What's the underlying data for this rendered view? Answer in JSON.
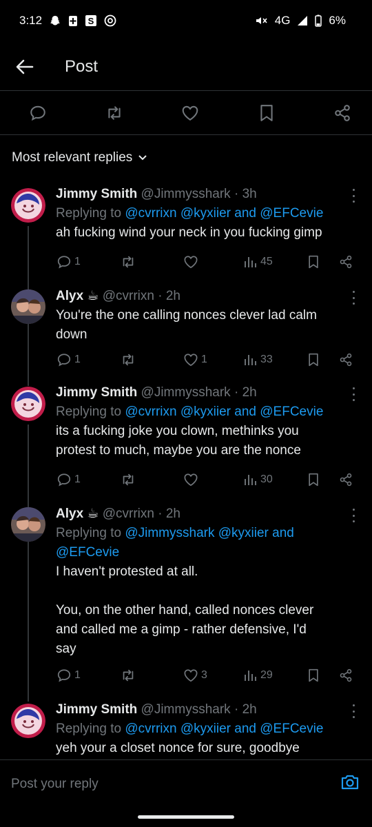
{
  "status": {
    "time": "3:12",
    "network": "4G",
    "battery": "6%"
  },
  "header": {
    "title": "Post"
  },
  "sort": {
    "label": "Most relevant replies"
  },
  "replies": [
    {
      "name": "Jimmy Smith",
      "handle": "@Jimmysshark",
      "dot": "·",
      "time": "3h",
      "replying_prefix": "Replying to ",
      "mentions": [
        "@cvrrixn",
        "@kyxiier",
        "and",
        "@EFCevie"
      ],
      "text": "ah fucking wind your neck in you fucking gimp",
      "counts": {
        "replies": "1",
        "reposts": "",
        "likes": "",
        "views": "45"
      }
    },
    {
      "name": "Alyx ☕",
      "handle": "@cvrrixn",
      "dot": "·",
      "time": "2h",
      "replying_prefix": "",
      "mentions": [],
      "text": "You're the one calling nonces clever lad calm\ndown",
      "counts": {
        "replies": "1",
        "reposts": "",
        "likes": "1",
        "views": "33"
      }
    },
    {
      "name": "Jimmy Smith",
      "handle": "@Jimmysshark",
      "dot": "·",
      "time": "2h",
      "replying_prefix": "Replying to ",
      "mentions": [
        "@cvrrixn",
        "@kyxiier",
        "and",
        "@EFCevie"
      ],
      "text": "its a fucking joke you clown, methinks you\nprotest to much, maybe you are the nonce",
      "counts": {
        "replies": "1",
        "reposts": "",
        "likes": "",
        "views": "30"
      }
    },
    {
      "name": "Alyx ☕",
      "handle": "@cvrrixn",
      "dot": "·",
      "time": "2h",
      "replying_prefix": "Replying to ",
      "mentions": [
        "@Jimmysshark",
        "@kyxiier",
        "and",
        "@EFCevie"
      ],
      "text": "I haven't protested at all.\n\nYou, on the other hand, called nonces clever\nand called me a gimp - rather defensive, I'd\nsay",
      "counts": {
        "replies": "1",
        "reposts": "",
        "likes": "3",
        "views": "29"
      }
    },
    {
      "name": "Jimmy Smith",
      "handle": "@Jimmysshark",
      "dot": "·",
      "time": "2h",
      "replying_prefix": "Replying to ",
      "mentions": [
        "@cvrrixn",
        "@kyxiier",
        "and",
        "@EFCevie"
      ],
      "text": "yeh your a closet nonce for sure, goodbye",
      "counts": {
        "replies": "",
        "reposts": "",
        "likes": "",
        "views": ""
      }
    }
  ],
  "composer": {
    "placeholder": "Post your reply"
  },
  "colors": {
    "accent": "#1d9bf0",
    "muted": "#71767b",
    "text": "#e7e9ea",
    "border": "#2f3336"
  }
}
